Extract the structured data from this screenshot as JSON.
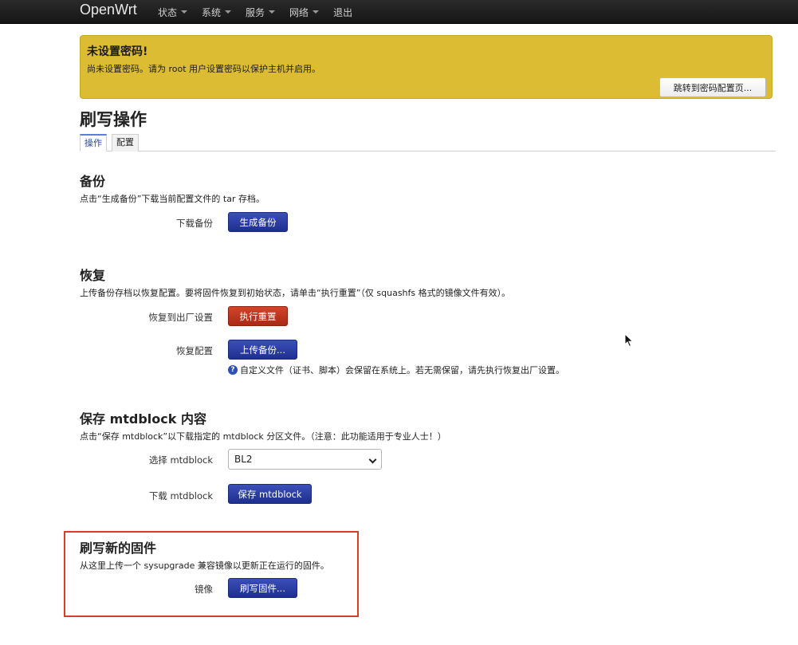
{
  "nav": {
    "brand": "OpenWrt",
    "items": [
      {
        "label": "状态",
        "has_dropdown": true
      },
      {
        "label": "系统",
        "has_dropdown": true
      },
      {
        "label": "服务",
        "has_dropdown": true
      },
      {
        "label": "网络",
        "has_dropdown": true
      },
      {
        "label": "退出",
        "has_dropdown": false
      }
    ]
  },
  "alert": {
    "title": "未设置密码!",
    "text": "尚未设置密码。请为 root 用户设置密码以保护主机并启用。",
    "button": "跳转到密码配置页..."
  },
  "page": {
    "title": "刷写操作",
    "tabs": [
      "操作",
      "配置"
    ],
    "active_tab": "操作"
  },
  "backup": {
    "title": "备份",
    "desc": "点击“生成备份”下载当前配置文件的 tar 存档。",
    "label": "下载备份",
    "button": "生成备份"
  },
  "restore": {
    "title": "恢复",
    "desc": "上传备份存档以恢复配置。要将固件恢复到初始状态，请单击“执行重置”（仅 squashfs 格式的镜像文件有效）。",
    "reset_label": "恢复到出厂设置",
    "reset_button": "执行重置",
    "upload_label": "恢复配置",
    "upload_button": "上传备份...",
    "help": "自定义文件（证书、脚本）会保留在系统上。若无需保留，请先执行恢复出厂设置。"
  },
  "mtd": {
    "title": "保存 mtdblock 内容",
    "desc": "点击“保存 mtdblock”以下载指定的 mtdblock 分区文件。（注意：此功能适用于专业人士！）",
    "select_label": "选择 mtdblock",
    "select_value": "BL2",
    "download_label": "下载 mtdblock",
    "button": "保存 mtdblock"
  },
  "flash": {
    "title": "刷写新的固件",
    "desc": "从这里上传一个 sysupgrade 兼容镜像以更新正在运行的固件。",
    "label": "镜像",
    "button": "刷写固件..."
  },
  "colors": {
    "navbar": "#1e1e1e",
    "alert": "#dcbc32",
    "primary_button": "#2a3ca3",
    "danger_button": "#c0391f",
    "highlight_border": "#d43f2a"
  }
}
